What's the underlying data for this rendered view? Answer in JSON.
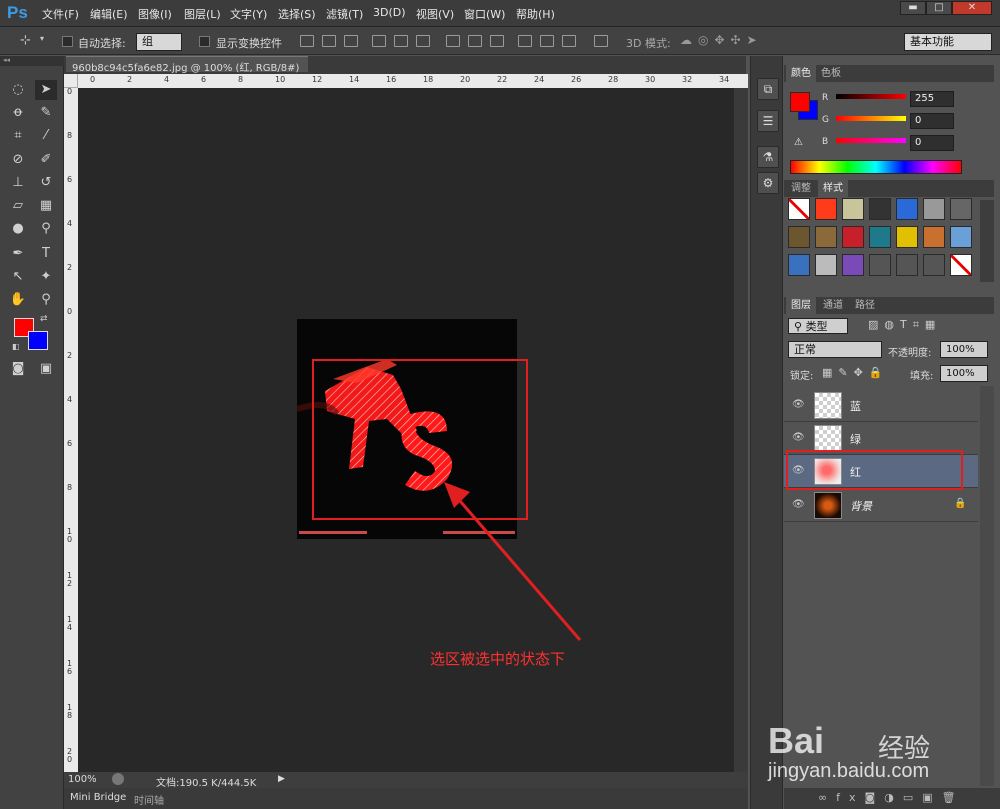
{
  "app": {
    "logo": "Ps"
  },
  "menu": [
    "文件(F)",
    "编辑(E)",
    "图像(I)",
    "图层(L)",
    "文字(Y)",
    "选择(S)",
    "滤镜(T)",
    "3D(D)",
    "视图(V)",
    "窗口(W)",
    "帮助(H)"
  ],
  "window_controls": {
    "minimize": "▬",
    "maximize": "□",
    "close": "✕"
  },
  "options": {
    "auto_select_label": "自动选择:",
    "auto_select_value": "组",
    "show_transform_label": "显示变换控件",
    "mode_3d_label": "3D 模式:",
    "workspace": "基本功能"
  },
  "document": {
    "tab_title": "960b8c94c5fa6e82.jpg @ 100% (红, RGB/8#) *",
    "zoom": "100%",
    "doc_size": "文档:190.5 K/444.5K"
  },
  "bottom_tabs": [
    "Mini Bridge",
    "时间轴"
  ],
  "ruler_top": [
    "0",
    "2",
    "4",
    "6",
    "8",
    "10",
    "12",
    "14",
    "16",
    "18",
    "20",
    "22",
    "24",
    "26",
    "28",
    "30",
    "32",
    "34"
  ],
  "ruler_left": [
    "0",
    "8",
    "6",
    "4",
    "2",
    "0",
    "2",
    "4",
    "6",
    "8",
    "1 0",
    "1 2",
    "1 4",
    "1 6",
    "1 8",
    "2 0"
  ],
  "color_panel": {
    "tabs": [
      "颜色",
      "色板"
    ],
    "r_label": "R",
    "g_label": "G",
    "b_label": "B",
    "r": "255",
    "g": "0",
    "b": "0",
    "fg_color": "#ff0000",
    "bg_color": "#0000ff"
  },
  "styles_panel": {
    "tabs": [
      "调整",
      "样式"
    ]
  },
  "layers_panel": {
    "tabs": [
      "图层",
      "通道",
      "路径"
    ],
    "filter_label": "类型",
    "blend_mode": "正常",
    "opacity_label": "不透明度:",
    "opacity": "100%",
    "lock_label": "锁定:",
    "fill_label": "填充:",
    "fill": "100%",
    "layers": [
      {
        "name": "蓝"
      },
      {
        "name": "绿"
      },
      {
        "name": "红"
      },
      {
        "name": "背景"
      }
    ]
  },
  "annotation": {
    "text": "选区被选中的状态下"
  },
  "watermark": {
    "brand": "Bai",
    "brand_cn": "经验",
    "url": "jingyan.baidu.com"
  }
}
